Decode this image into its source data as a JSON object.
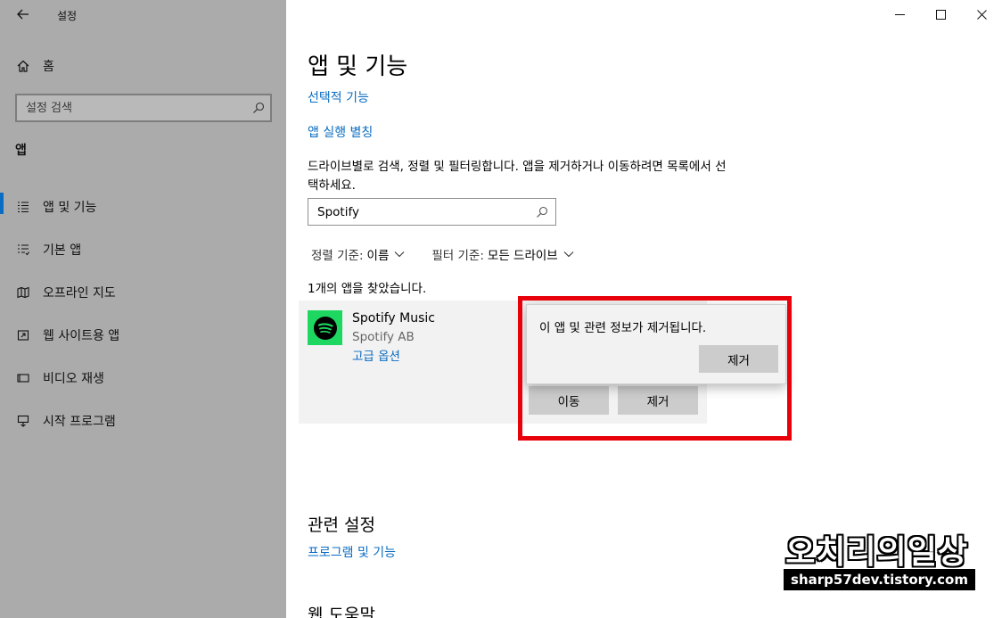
{
  "window": {
    "title": "설정",
    "back_icon": "back-arrow-icon",
    "controls": [
      "minimize-icon",
      "maximize-icon",
      "close-icon"
    ]
  },
  "sidebar": {
    "home_label": "홈",
    "search_placeholder": "설정 검색",
    "section_label": "앱",
    "items": [
      {
        "label": "앱 및 기능",
        "icon": "list-icon",
        "active": true
      },
      {
        "label": "기본 앱",
        "icon": "list-default-icon",
        "active": false
      },
      {
        "label": "오프라인 지도",
        "icon": "map-icon",
        "active": false
      },
      {
        "label": "웹 사이트용 앱",
        "icon": "open-in-app-icon",
        "active": false
      },
      {
        "label": "비디오 재생",
        "icon": "video-icon",
        "active": false
      },
      {
        "label": "시작 프로그램",
        "icon": "startup-icon",
        "active": false
      }
    ]
  },
  "main": {
    "title": "앱 및 기능",
    "link_optional": "선택적 기능",
    "link_alias": "앱 실행 별칭",
    "description": "드라이브별로 검색, 정렬 및 필터링합니다. 앱을 제거하거나 이동하려면 목록에서 선택하세요.",
    "search_value": "Spotify",
    "sort_label": "정렬 기준:",
    "sort_value": "이름",
    "filter_label": "필터 기준:",
    "filter_value": "모든 드라이브",
    "found_text": "1개의 앱을 찾았습니다.",
    "app": {
      "name": "Spotify Music",
      "publisher": "Spotify AB",
      "advanced_link": "고급 옵션",
      "move_button": "이동",
      "uninstall_button": "제거",
      "icon_color": "#1ed760"
    },
    "flyout": {
      "message": "이 앱 및 관련 정보가 제거됩니다.",
      "uninstall_button": "제거"
    },
    "related_title": "관련 설정",
    "related_link": "프로그램 및 기능",
    "help_title": "웹 도움말"
  },
  "watermark": {
    "title": "오치리의일상",
    "url": "sharp57dev.tistory.com"
  },
  "colors": {
    "accent": "#0a6cc2",
    "sidebar_bg": "#ababab",
    "highlight": "#e8000b",
    "spotify": "#1ed760"
  }
}
